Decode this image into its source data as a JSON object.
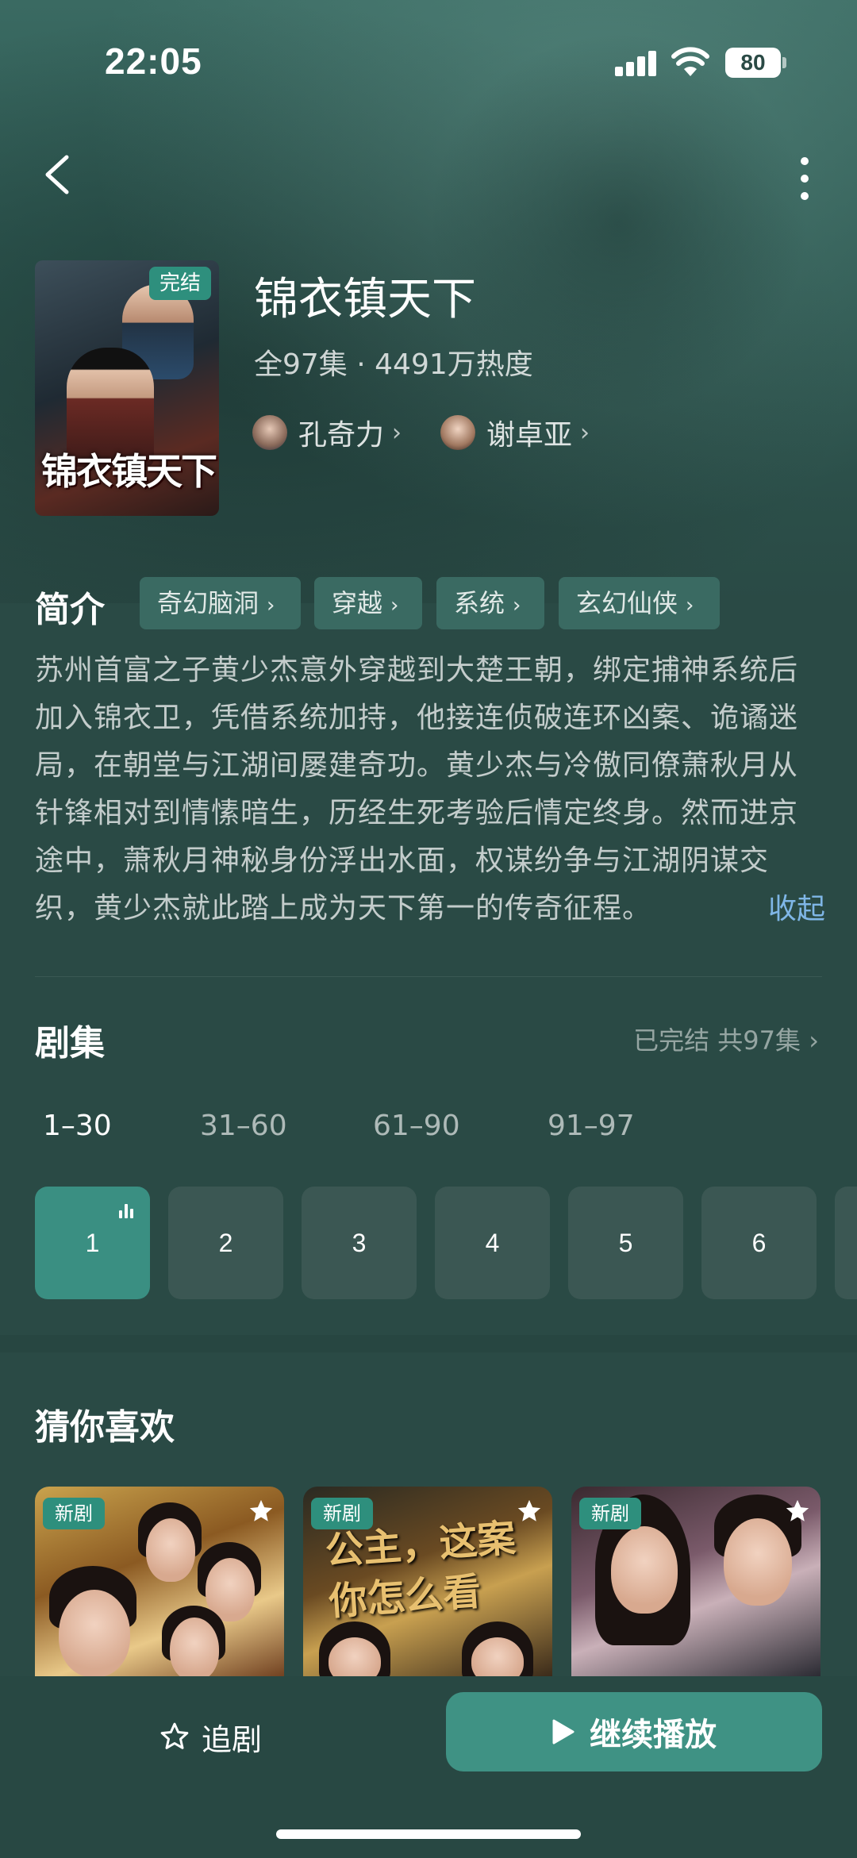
{
  "status_bar": {
    "time": "22:05",
    "battery": "80",
    "icons": [
      "signal-icon",
      "wifi-icon",
      "battery-icon"
    ]
  },
  "nav": {
    "back_icon": "chevron-left-icon",
    "more_icon": "more-vertical-icon"
  },
  "drama": {
    "poster_title": "锦衣镇天下",
    "badge": "完结",
    "title": "锦衣镇天下",
    "meta": "全97集 · 4491万热度",
    "actors": [
      {
        "name": "孔奇力",
        "chevron": "›"
      },
      {
        "name": "谢卓亚",
        "chevron": "›"
      }
    ]
  },
  "intro": {
    "heading": "简介",
    "tags": [
      {
        "label": "奇幻脑洞",
        "chevron": "›"
      },
      {
        "label": "穿越",
        "chevron": "›"
      },
      {
        "label": "系统",
        "chevron": "›"
      },
      {
        "label": "玄幻仙侠",
        "chevron": "›"
      }
    ],
    "text": "苏州首富之子黄少杰意外穿越到大楚王朝，绑定捕神系统后加入锦衣卫，凭借系统加持，他接连侦破连环凶案、诡谲迷局，在朝堂与江湖间屡建奇功。黄少杰与冷傲同僚萧秋月从针锋相对到情愫暗生，历经生死考验后情定终身。然而进京途中，萧秋月神秘身份浮出水面，权谋纷争与江湖阴谋交织，黄少杰就此踏上成为天下第一的传奇征程。",
    "collapse": "收起"
  },
  "episodes": {
    "heading": "剧集",
    "status": "已完结 共97集 ›",
    "ranges": [
      "1–30",
      "31–60",
      "61–90",
      "91–97"
    ],
    "active_range": 0,
    "buttons": [
      "1",
      "2",
      "3",
      "4",
      "5",
      "6"
    ],
    "active_episode": 0
  },
  "recommend": {
    "heading": "猜你喜欢",
    "cards": [
      {
        "badge": "新剧"
      },
      {
        "badge": "新剧",
        "overlay": "公主，这案你怎么看"
      },
      {
        "badge": "新剧"
      }
    ]
  },
  "bottom": {
    "follow_label": "追剧",
    "play_label": "继续播放"
  },
  "colors": {
    "accent": "#2e8f7d",
    "play_button": "#3f9284",
    "background": "#2a4a45",
    "link": "#7fb6e6"
  }
}
